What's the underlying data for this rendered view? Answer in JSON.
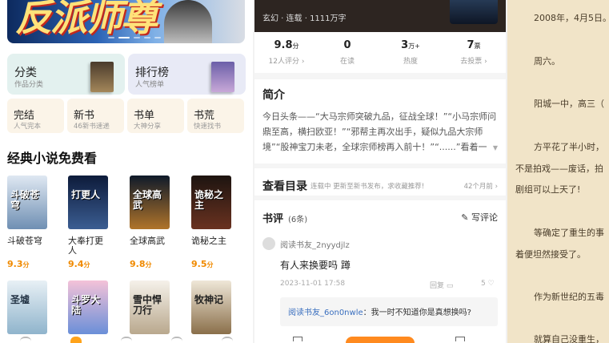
{
  "store": {
    "banner_title": "反派师尊",
    "categories_big": [
      {
        "title": "分类",
        "subtitle": "作品分类",
        "book_text": "幻"
      },
      {
        "title": "排行榜",
        "subtitle": "人气榜单",
        "book_text": "修"
      }
    ],
    "categories_small": [
      {
        "title": "完结",
        "subtitle": "人气完本"
      },
      {
        "title": "新书",
        "subtitle": "46新书速递"
      },
      {
        "title": "书单",
        "subtitle": "大神分享"
      },
      {
        "title": "书荒",
        "subtitle": "快速找书"
      }
    ],
    "section_title": "经典小说免费看",
    "books": [
      {
        "name": "斗破苍穹",
        "score": "9.3",
        "cover_text": "斗破苍穹"
      },
      {
        "name": "大奉打更人",
        "score": "9.4",
        "cover_text": "打更人"
      },
      {
        "name": "全球高武",
        "score": "9.8",
        "cover_text": "全球高武"
      },
      {
        "name": "诡秘之主",
        "score": "9.5",
        "cover_text": "诡秘之主"
      }
    ],
    "books_row2": [
      {
        "cover_text": "圣墟"
      },
      {
        "cover_text": "斗罗大陆"
      },
      {
        "cover_text": "雪中悍刀行"
      },
      {
        "cover_text": "牧神记"
      }
    ],
    "score_unit": "分"
  },
  "detail": {
    "meta": "玄幻 · 连载 · 1111万字",
    "stats": [
      {
        "value": "9.8",
        "unit": "分",
        "label": "12人评分 ›"
      },
      {
        "value": "0",
        "unit": "",
        "label": "在读"
      },
      {
        "value": "3",
        "unit": "万+",
        "label": "热度"
      },
      {
        "value": "7",
        "unit": "票",
        "label": "去投票 ›"
      }
    ],
    "intro_title": "简介",
    "intro_text": "今日头条——“大马宗师突破九品，征战全球！”“小马宗师问鼎至高，横扫欧亚！”“邪帮主再次出手，疑似九品大宗师境”“股神宝刀未老，全球宗师榜再入前十！”“......”看着一",
    "toc_title": "查看目录",
    "toc_sub": "连载中 更新至新书发布，求收藏推荐!",
    "toc_right": "42个月前 ›",
    "review_title": "书评",
    "review_count": "(6条)",
    "write_review": "写评论",
    "review": {
      "user": "阅读书友_2nyydjlz",
      "text": "有人来换要吗 蹲",
      "date": "2023-11-01 17:58",
      "reply": "回复",
      "likes": "5"
    },
    "sub_reply": {
      "user": "阅读书友_6on0nwle",
      "text": "：我一时不知道你是真想换吗?"
    }
  },
  "reader": {
    "paragraphs": [
      "2008年，4月5日。",
      "周六。",
      "阳城一中，高三（",
      "方平花了半小时，",
      "不是拍戏——废话，拍",
      "剧组可以上天了!",
      "等确定了重生的事",
      "着便坦然接受了。",
      "作为新世纪的五毒",
      "就算自己没重生，"
    ]
  }
}
